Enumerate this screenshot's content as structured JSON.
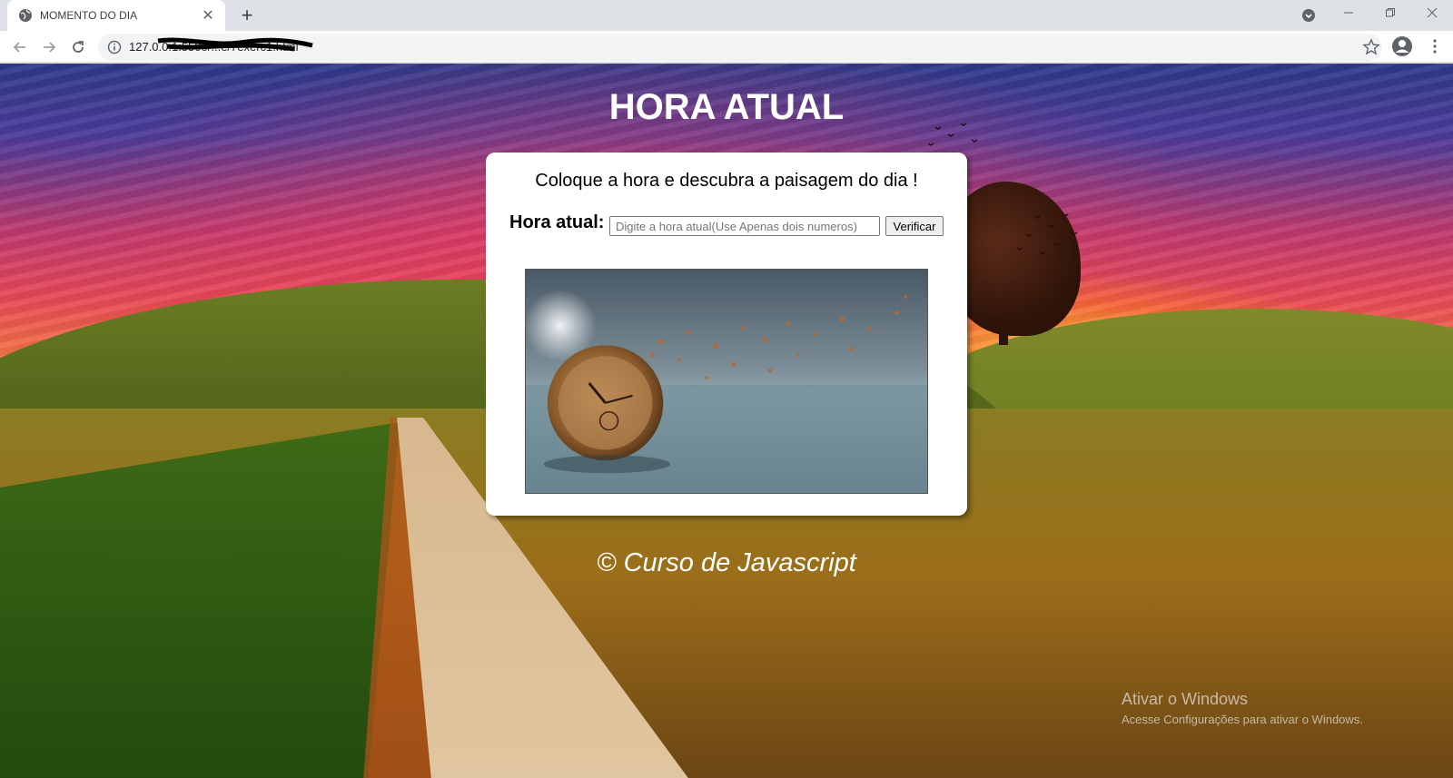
{
  "browser": {
    "tab_title": "MOMENTO DO DIA",
    "url": "127.0.0.1:5500/...e/7exerc1.html",
    "new_tab_label": "+",
    "close_tab_label": "✕"
  },
  "page": {
    "title": "HORA ATUAL",
    "intro": "Coloque a hora e descubra a paisagem do dia !",
    "hora_label": "Hora atual:",
    "hora_input_value": "",
    "hora_input_placeholder": "Digite a hora atual(Use Apenas dois numeros)",
    "verify_button": "Verificar",
    "footer": "© Curso de Javascript"
  },
  "os_overlay": {
    "title": "Ativar o Windows",
    "subtitle": "Acesse Configurações para ativar o Windows."
  },
  "colors": {
    "chrome_bg": "#dee1e6",
    "card_bg": "#ffffff",
    "title_color": "#ffffff"
  }
}
